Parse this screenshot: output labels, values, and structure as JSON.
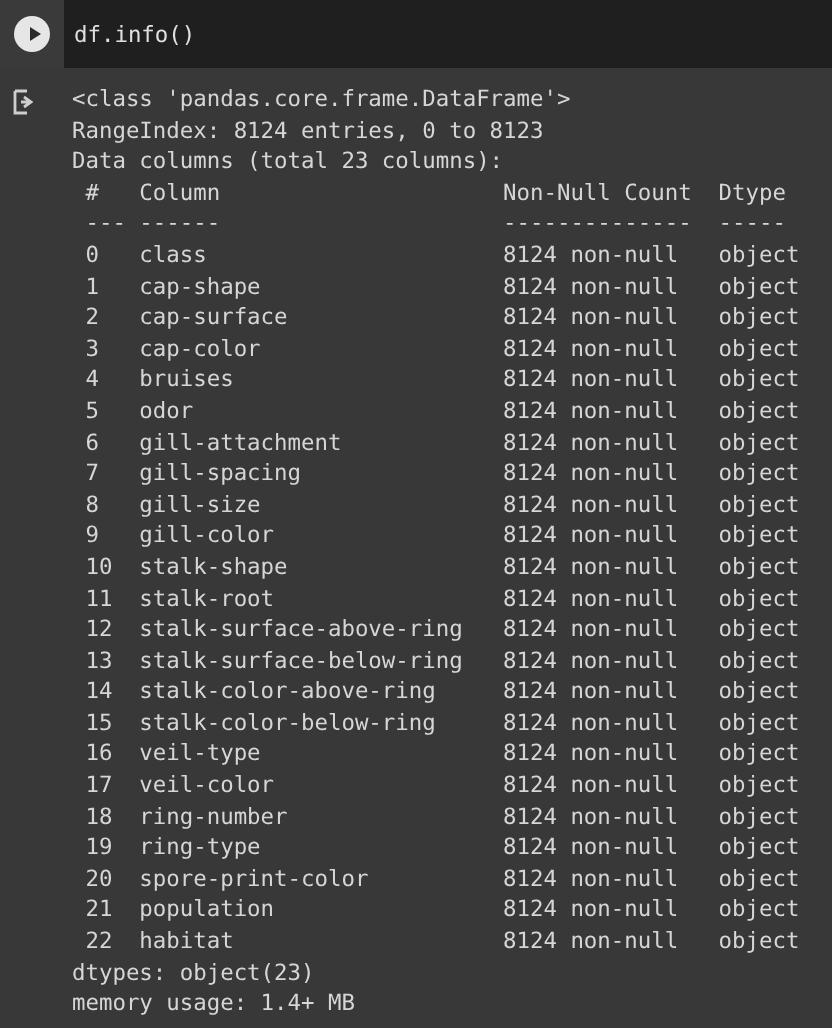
{
  "cell": {
    "code": "df.info()"
  },
  "output": {
    "intro": [
      "<class 'pandas.core.frame.DataFrame'>",
      "RangeIndex: 8124 entries, 0 to 8123",
      "Data columns (total 23 columns):"
    ],
    "header": [
      "#",
      "Column",
      "Non-Null Count",
      "Dtype"
    ],
    "separator": [
      "---",
      "------",
      "--------------",
      "-----"
    ],
    "rows": [
      {
        "index": "0",
        "column": "class",
        "count": "8124 non-null",
        "dtype": "object"
      },
      {
        "index": "1",
        "column": "cap-shape",
        "count": "8124 non-null",
        "dtype": "object"
      },
      {
        "index": "2",
        "column": "cap-surface",
        "count": "8124 non-null",
        "dtype": "object"
      },
      {
        "index": "3",
        "column": "cap-color",
        "count": "8124 non-null",
        "dtype": "object"
      },
      {
        "index": "4",
        "column": "bruises",
        "count": "8124 non-null",
        "dtype": "object"
      },
      {
        "index": "5",
        "column": "odor",
        "count": "8124 non-null",
        "dtype": "object"
      },
      {
        "index": "6",
        "column": "gill-attachment",
        "count": "8124 non-null",
        "dtype": "object"
      },
      {
        "index": "7",
        "column": "gill-spacing",
        "count": "8124 non-null",
        "dtype": "object"
      },
      {
        "index": "8",
        "column": "gill-size",
        "count": "8124 non-null",
        "dtype": "object"
      },
      {
        "index": "9",
        "column": "gill-color",
        "count": "8124 non-null",
        "dtype": "object"
      },
      {
        "index": "10",
        "column": "stalk-shape",
        "count": "8124 non-null",
        "dtype": "object"
      },
      {
        "index": "11",
        "column": "stalk-root",
        "count": "8124 non-null",
        "dtype": "object"
      },
      {
        "index": "12",
        "column": "stalk-surface-above-ring",
        "count": "8124 non-null",
        "dtype": "object"
      },
      {
        "index": "13",
        "column": "stalk-surface-below-ring",
        "count": "8124 non-null",
        "dtype": "object"
      },
      {
        "index": "14",
        "column": "stalk-color-above-ring",
        "count": "8124 non-null",
        "dtype": "object"
      },
      {
        "index": "15",
        "column": "stalk-color-below-ring",
        "count": "8124 non-null",
        "dtype": "object"
      },
      {
        "index": "16",
        "column": "veil-type",
        "count": "8124 non-null",
        "dtype": "object"
      },
      {
        "index": "17",
        "column": "veil-color",
        "count": "8124 non-null",
        "dtype": "object"
      },
      {
        "index": "18",
        "column": "ring-number",
        "count": "8124 non-null",
        "dtype": "object"
      },
      {
        "index": "19",
        "column": "ring-type",
        "count": "8124 non-null",
        "dtype": "object"
      },
      {
        "index": "20",
        "column": "spore-print-color",
        "count": "8124 non-null",
        "dtype": "object"
      },
      {
        "index": "21",
        "column": "population",
        "count": "8124 non-null",
        "dtype": "object"
      },
      {
        "index": "22",
        "column": "habitat",
        "count": "8124 non-null",
        "dtype": "object"
      }
    ],
    "footer": [
      "dtypes: object(23)",
      "memory usage: 1.4+ MB"
    ]
  }
}
